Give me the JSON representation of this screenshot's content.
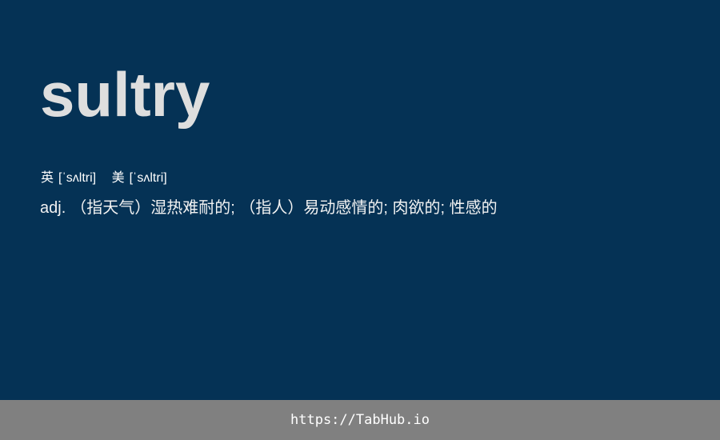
{
  "entry": {
    "word": "sultry",
    "phonetics": [
      {
        "label": "英",
        "ipa": "[ˈsʌltri]"
      },
      {
        "label": "美",
        "ipa": "[ˈsʌltri]"
      }
    ],
    "definition": {
      "pos": "adj.",
      "meaning": "（指天气）湿热难耐的; （指人）易动感情的; 肉欲的; 性感的"
    }
  },
  "footer": {
    "url": "https://TabHub.io"
  },
  "colors": {
    "background": "#053255",
    "footer_background": "#808080",
    "word_text": "#dedede",
    "body_text": "#ffffff"
  }
}
